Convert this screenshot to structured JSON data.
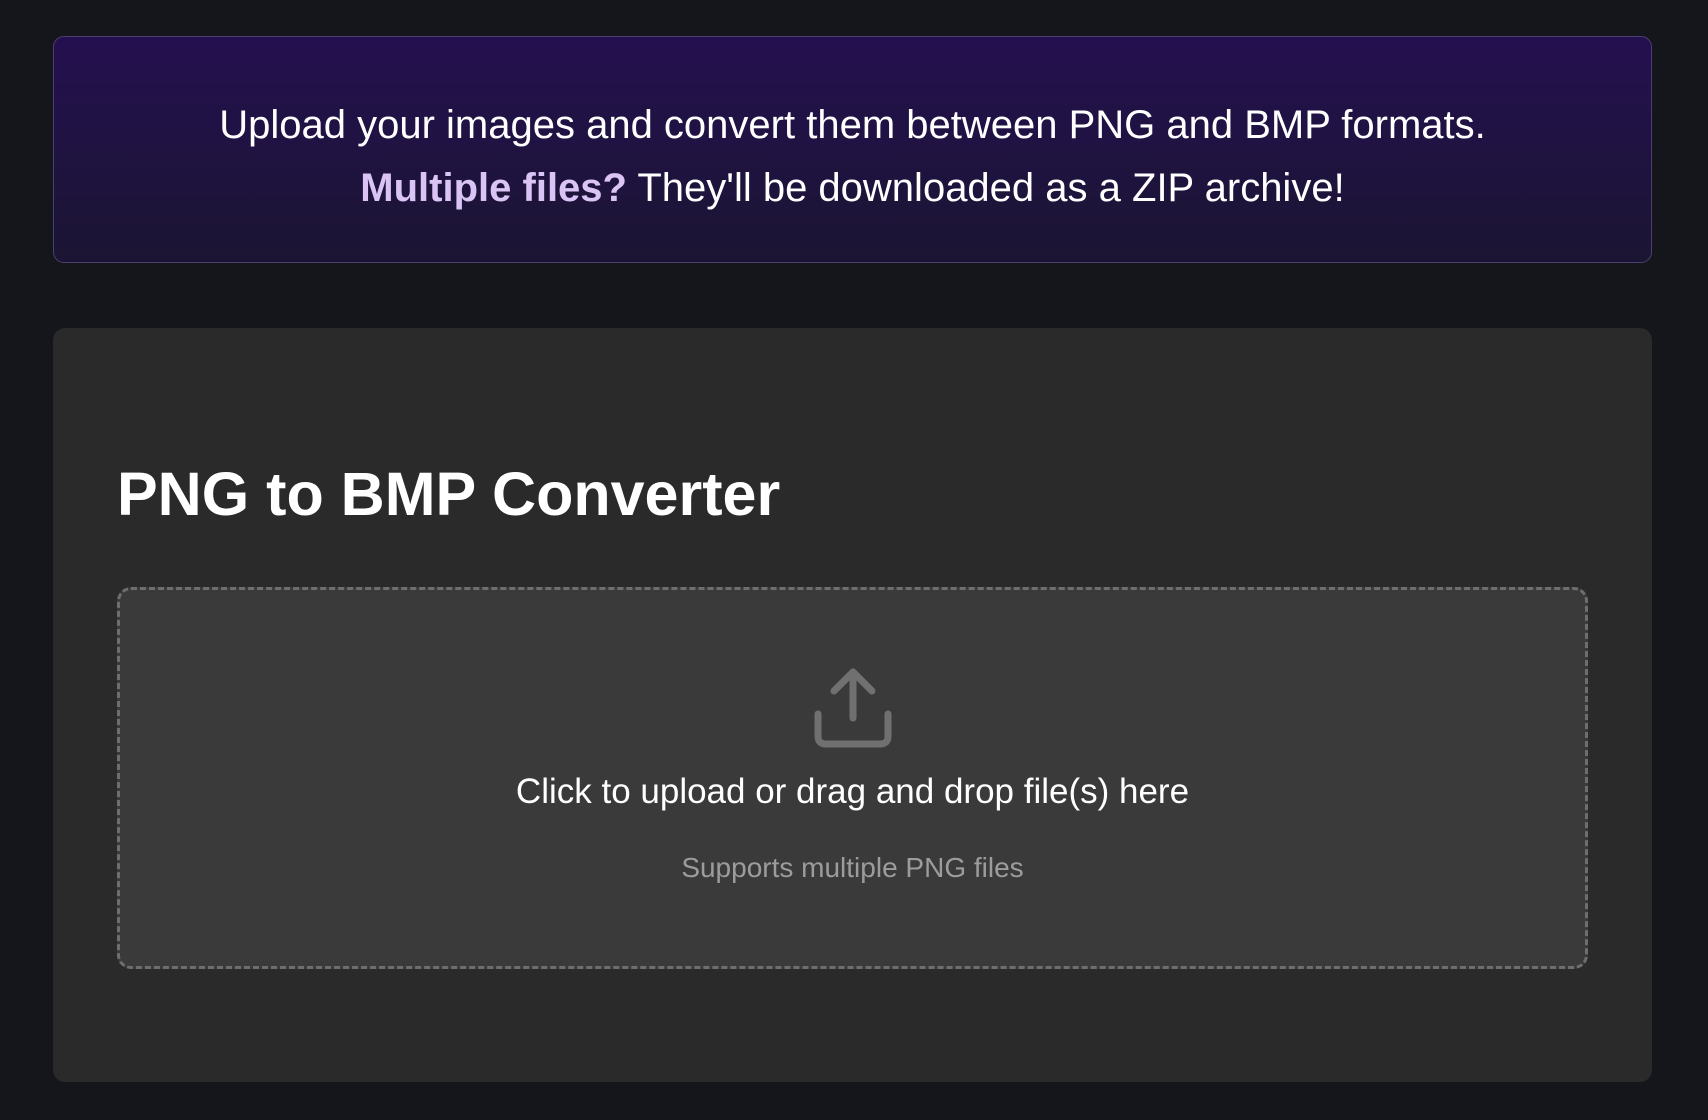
{
  "banner": {
    "line1": "Upload your images and convert them between PNG and BMP formats.",
    "line2_emphasis": "Multiple files?",
    "line2_rest": " They'll be downloaded as a ZIP archive!"
  },
  "converter": {
    "title": "PNG to BMP Converter",
    "dropzone": {
      "icon": "upload-icon",
      "main_text": "Click to upload or drag and drop file(s) here",
      "sub_text": "Supports multiple PNG files"
    }
  },
  "colors": {
    "page_background": "#15161b",
    "banner_background": "#24104f",
    "banner_border": "#4a3f70",
    "emphasis_text": "#d9c4f5",
    "card_background": "#2a2a2a",
    "dropzone_background": "#3a3a3a",
    "dropzone_border": "#6e6e6e",
    "muted_text": "#9c9c9c"
  }
}
